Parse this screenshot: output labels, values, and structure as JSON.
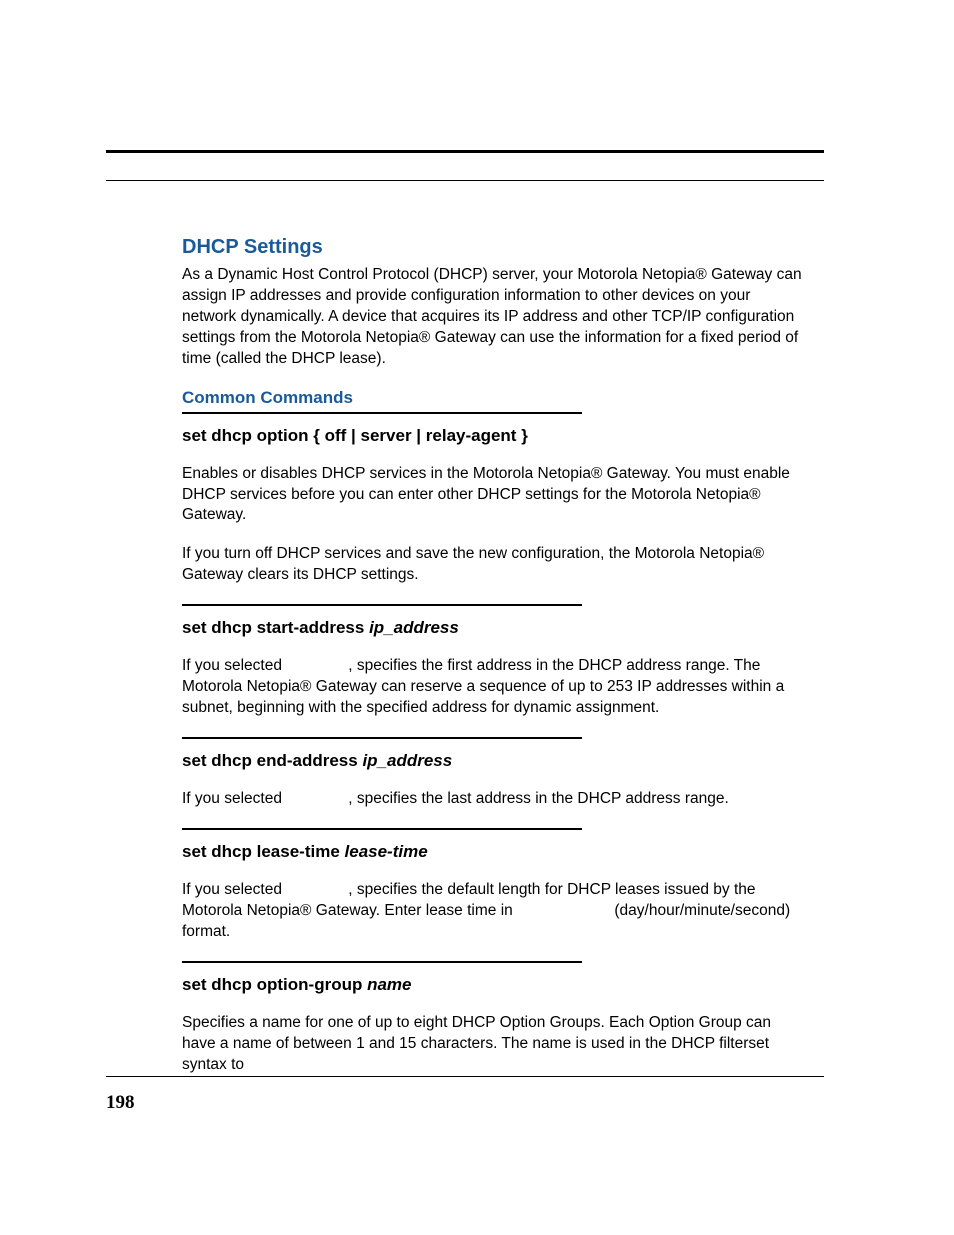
{
  "page_number": "198",
  "section": {
    "title": "DHCP Settings",
    "intro": "As a Dynamic Host Control Protocol (DHCP) server, your Motorola Netopia® Gateway can assign IP addresses and provide configuration information to other devices on your network dynamically. A device that acquires its IP address and other TCP/IP configuration settings from the Motorola Netopia® Gateway can use the information for a fixed period of time (called the DHCP lease)."
  },
  "subsection_title": "Common Commands",
  "commands": [
    {
      "heading_plain": "set dhcp option { off | server | relay-agent }",
      "heading_ital": "",
      "paragraphs": [
        "Enables or disables DHCP services in the Motorola Netopia® Gateway. You must enable DHCP services before you can enter other DHCP settings for the Motorola Netopia® Gateway.",
        "If you turn off DHCP services and save the new configuration, the Motorola Netopia® Gateway clears its DHCP settings."
      ]
    },
    {
      "heading_plain": "set dhcp start-address ",
      "heading_ital": "ip_address",
      "paragraphs": [
        "If you selected     , specifies the first address in the DHCP address range. The Motorola Netopia® Gateway can reserve a sequence of up to 253 IP addresses within a subnet, beginning with the specified address for dynamic assignment."
      ]
    },
    {
      "heading_plain": "set dhcp end-address ",
      "heading_ital": "ip_address",
      "paragraphs": [
        "If you selected     , specifies the last address in the DHCP address range."
      ]
    },
    {
      "heading_plain": "set dhcp lease-time ",
      "heading_ital": "lease-time",
      "paragraphs": [
        "If you selected     , specifies the default length for DHCP leases issued by the Motorola Netopia® Gateway. Enter lease time in        (day/hour/minute/second) format."
      ]
    },
    {
      "heading_plain": "set dhcp option-group ",
      "heading_ital": "name",
      "paragraphs": [
        "Specifies a name for one of up to eight DHCP Option Groups. Each Option Group can have a name of between 1 and 15 characters. The name is used in the DHCP filterset syntax to"
      ]
    }
  ]
}
